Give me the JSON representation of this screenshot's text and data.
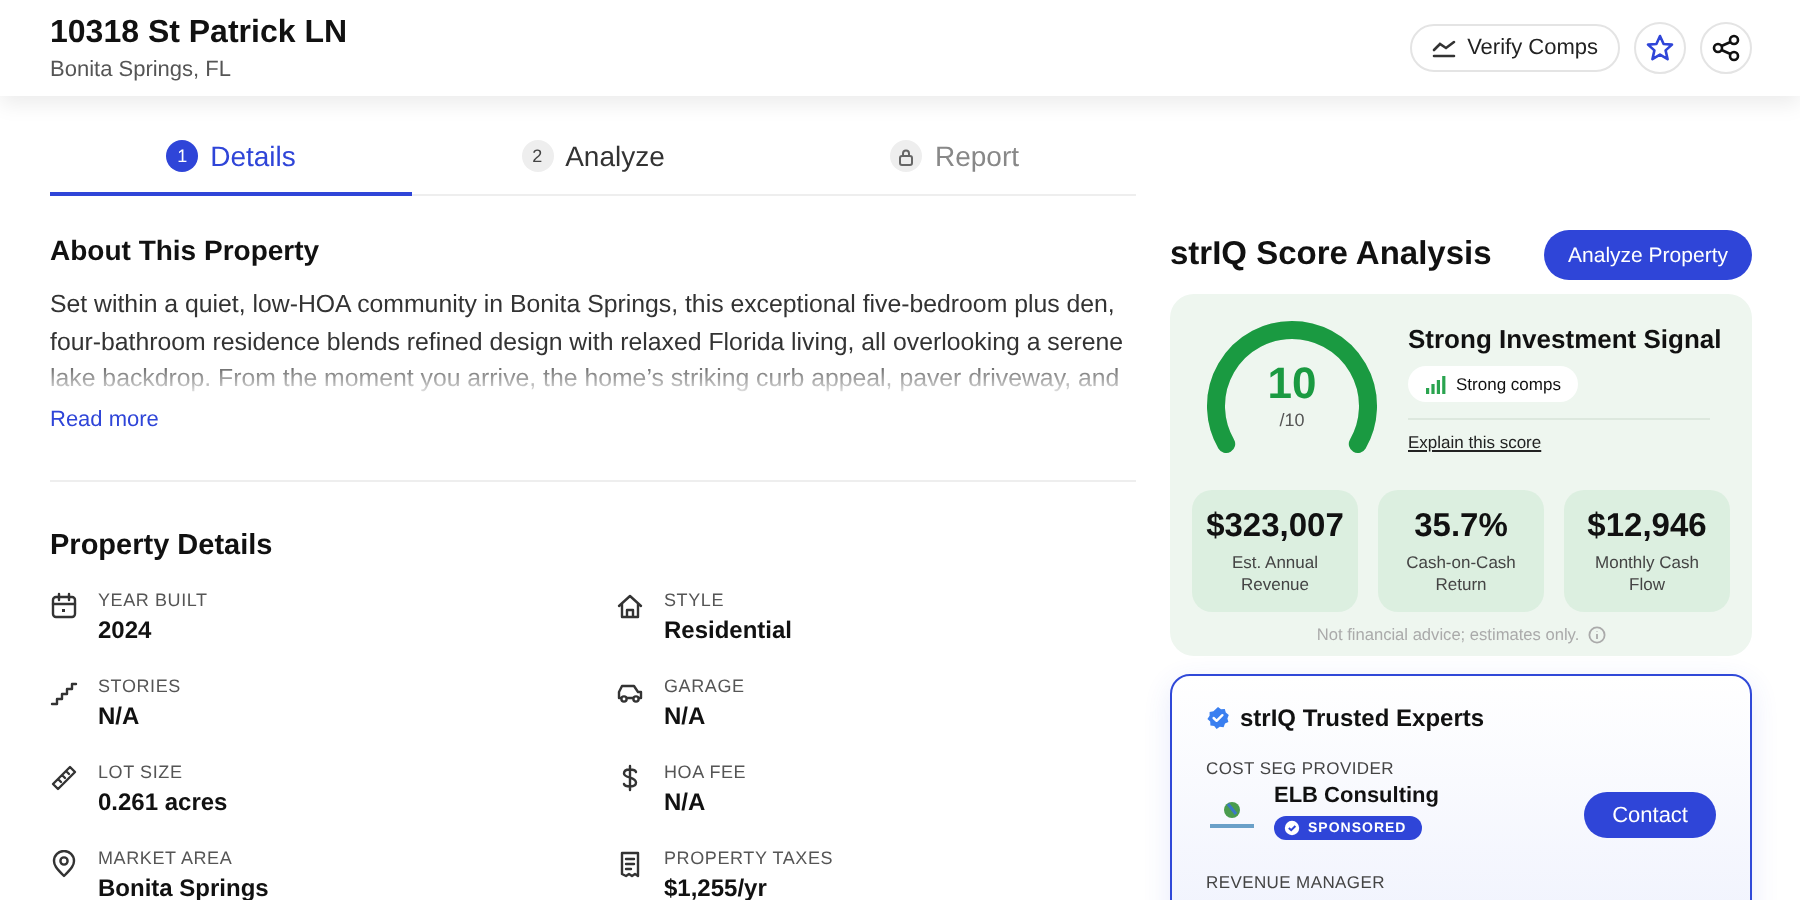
{
  "header": {
    "title": "10318 St Patrick LN",
    "subtitle": "Bonita Springs, FL",
    "verify_button": "Verify Comps",
    "favorite": {
      "selected": false
    }
  },
  "tabs": [
    {
      "kind": "number",
      "number": "1",
      "label": "Details",
      "selected": true
    },
    {
      "kind": "number",
      "number": "2",
      "label": "Analyze",
      "selected": false
    },
    {
      "kind": "locked",
      "label": "Report",
      "selected": false
    }
  ],
  "about": {
    "heading": "About This Property",
    "text": "Set within a quiet, low-HOA community in Bonita Springs, this exceptional five-bedroom plus den, four-bathroom residence blends refined design with relaxed Florida living, all overlooking a serene lake backdrop. From the moment you arrive, the home’s striking curb appeal, paver driveway, and",
    "link": "Read more"
  },
  "details": {
    "heading": "Property Details",
    "items": [
      {
        "kind": "calendar",
        "label": "YEAR BUILT",
        "value": "2024"
      },
      {
        "kind": "house",
        "label": "STYLE",
        "value": "Residential"
      },
      {
        "kind": "stairs",
        "label": "STORIES",
        "value": "N/A"
      },
      {
        "kind": "car",
        "label": "GARAGE",
        "value": "N/A"
      },
      {
        "kind": "ruler",
        "label": "LOT SIZE",
        "value": "0.261 acres"
      },
      {
        "kind": "dollar",
        "label": "HOA FEE",
        "value": "N/A"
      },
      {
        "kind": "pin",
        "label": "MARKET AREA",
        "value": "Bonita Springs"
      },
      {
        "kind": "receipt",
        "label": "PROPERTY TAXES",
        "value": "$1,255/yr"
      }
    ]
  },
  "score": {
    "title": "strIQ Score Analysis",
    "button": "Analyze Property",
    "value": "10",
    "max": "/10",
    "level": 1.0,
    "signal": "Strong Investment Signal",
    "badge": "Strong comps",
    "link": "Explain this score",
    "stats": [
      {
        "value": "$323,007",
        "label": "Est. Annual Revenue"
      },
      {
        "value": "35.7%",
        "label": "Cash-on-Cash Return"
      },
      {
        "value": "$12,946",
        "label": "Monthly Cash Flow"
      }
    ],
    "disclaimer": "Not financial advice; estimates only."
  },
  "experts": {
    "title": "strIQ Trusted Experts",
    "entries": [
      {
        "role": "COST SEG PROVIDER",
        "name": "ELB Consulting",
        "badge": "SPONSORED",
        "button": "Contact"
      },
      {
        "role": "REVENUE MANAGER"
      }
    ]
  }
}
